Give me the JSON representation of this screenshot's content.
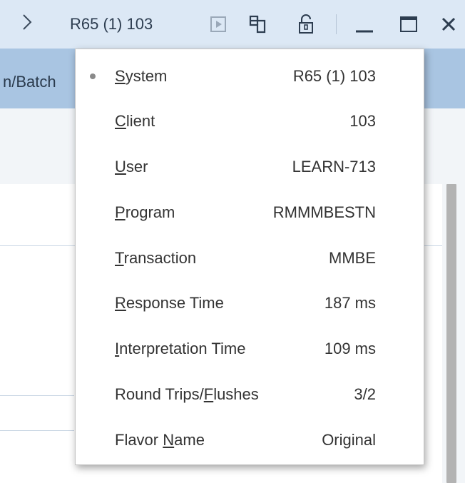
{
  "titlebar": {
    "system_text": "R65 (1) 103"
  },
  "background": {
    "column_header_fragment": "n/Batch"
  },
  "status_menu": {
    "items": [
      {
        "label_pre": "",
        "mnemonic": "S",
        "label_post": "ystem",
        "value": "R65 (1) 103",
        "selected": true
      },
      {
        "label_pre": "",
        "mnemonic": "C",
        "label_post": "lient",
        "value": "103",
        "selected": false
      },
      {
        "label_pre": "",
        "mnemonic": "U",
        "label_post": "ser",
        "value": "LEARN-713",
        "selected": false
      },
      {
        "label_pre": "",
        "mnemonic": "P",
        "label_post": "rogram",
        "value": "RMMMBESTN",
        "selected": false
      },
      {
        "label_pre": "",
        "mnemonic": "T",
        "label_post": "ransaction",
        "value": "MMBE",
        "selected": false
      },
      {
        "label_pre": "",
        "mnemonic": "R",
        "label_post": "esponse Time",
        "value": "187 ms",
        "selected": false
      },
      {
        "label_pre": "",
        "mnemonic": "I",
        "label_post": "nterpretation Time",
        "value": "109 ms",
        "selected": false
      },
      {
        "label_pre": "Round Trips/",
        "mnemonic": "F",
        "label_post": "lushes",
        "value": "3/2",
        "selected": false
      },
      {
        "label_pre": "Flavor ",
        "mnemonic": "N",
        "label_post": "ame",
        "value": "Original",
        "selected": false
      }
    ]
  },
  "icons": {
    "expand": "chevron-right-icon",
    "play": "play-icon",
    "layout": "layout-icon",
    "lock": "lock-icon",
    "minimize": "minimize-icon",
    "maximize": "maximize-icon",
    "close": "close-icon"
  },
  "colors": {
    "titlebar_bg": "#dce8f5",
    "header_band_bg": "#a9c5e2",
    "text": "#333333",
    "bullet": "#8a8a8a"
  }
}
